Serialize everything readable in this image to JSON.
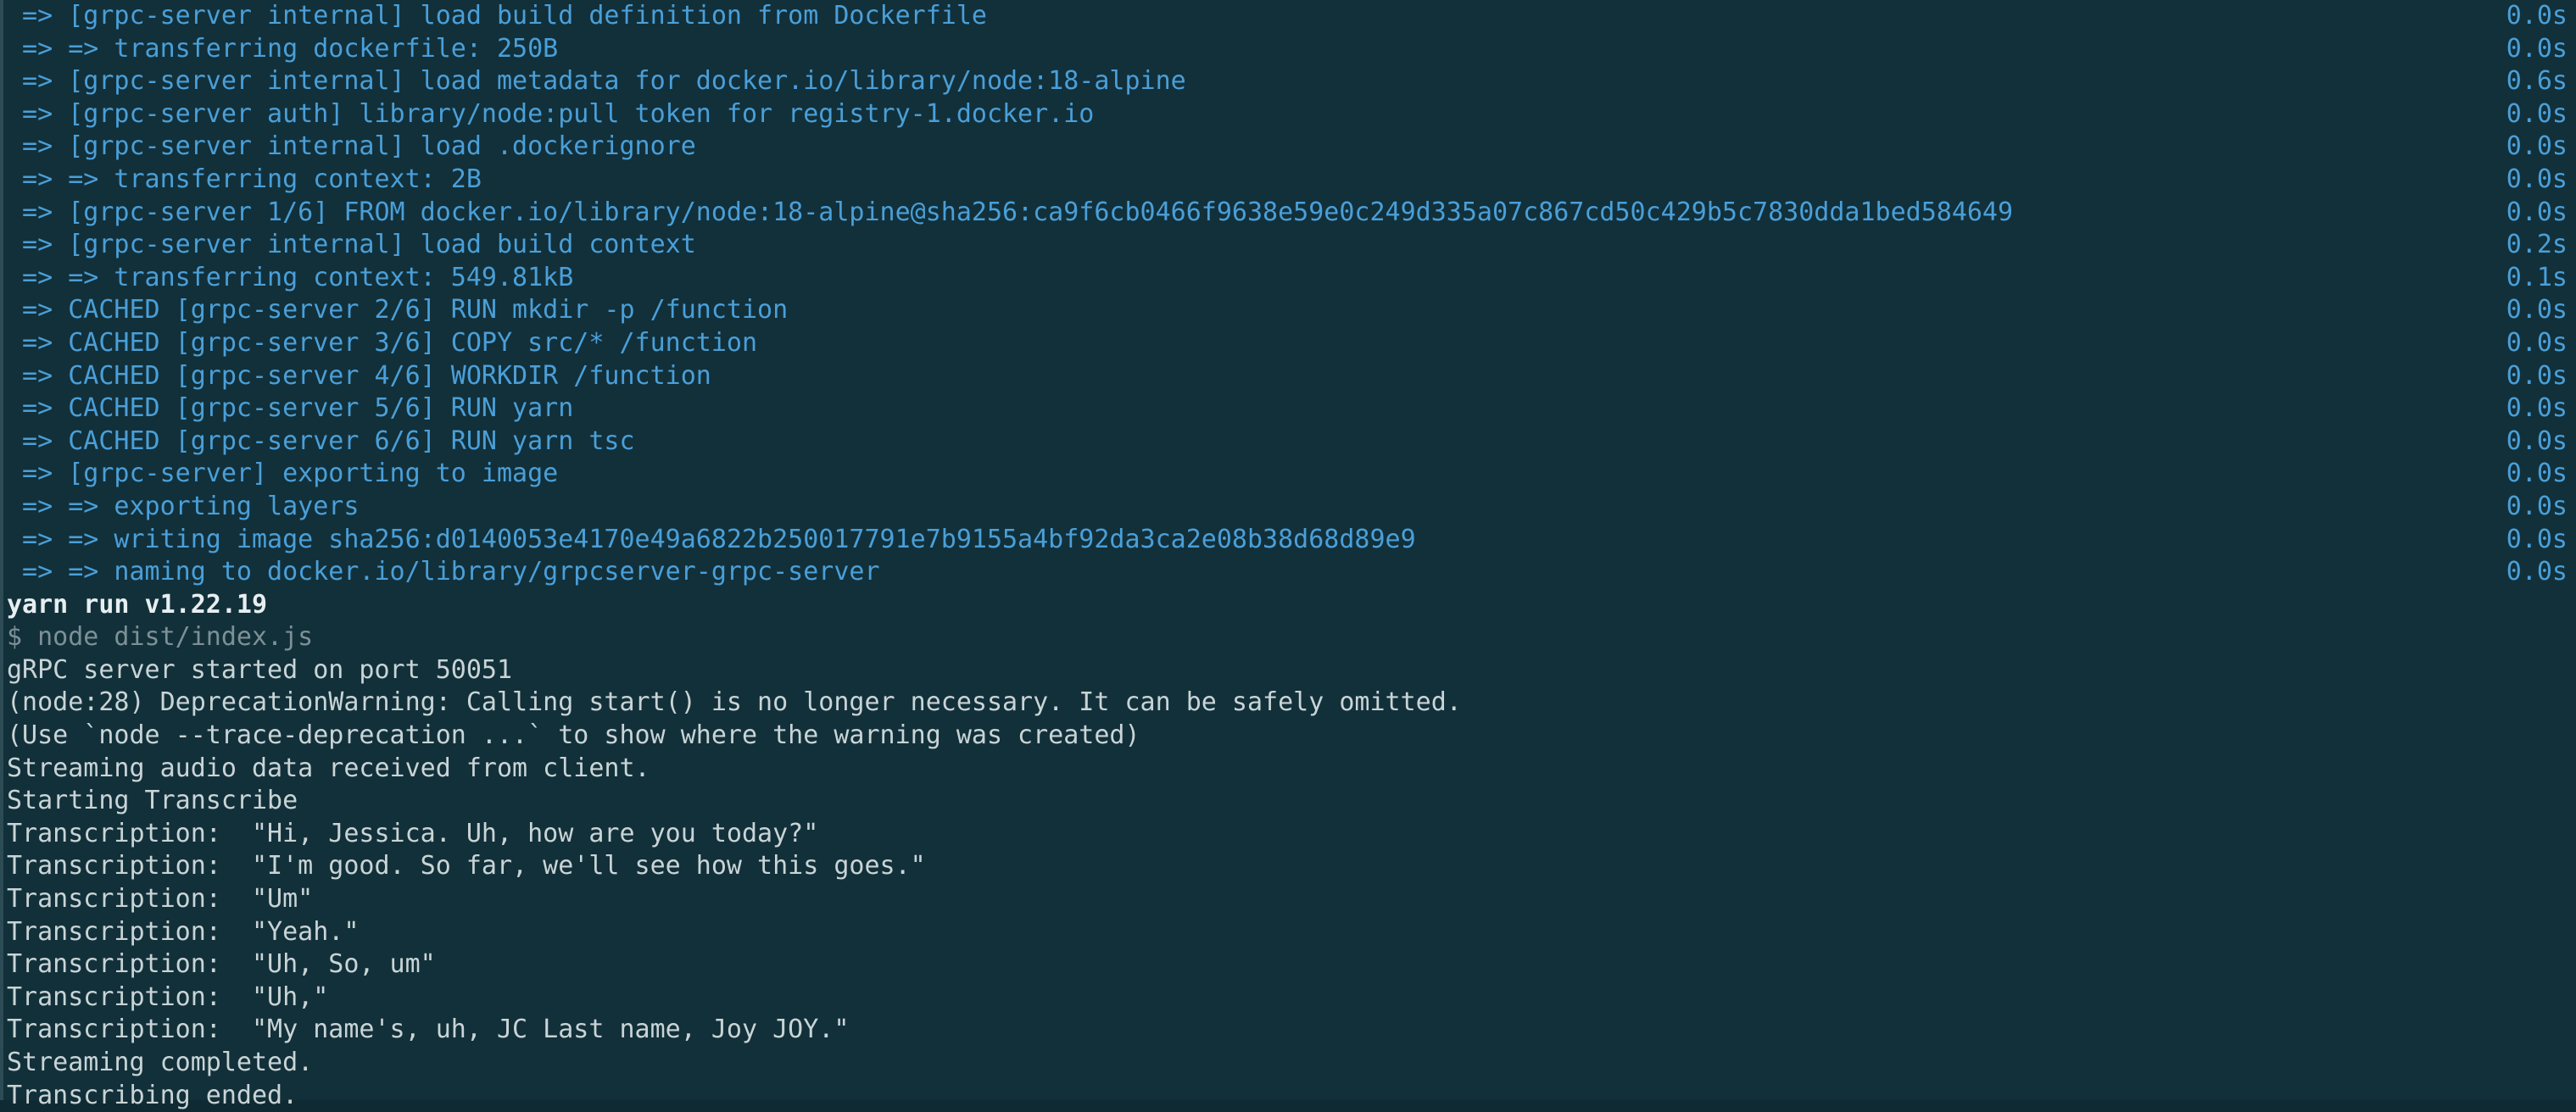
{
  "terminal": {
    "background": "#12303a",
    "build_color": "#4a9fd8",
    "output_color": "#c9d4d6",
    "bold_color": "#e7eef0",
    "dim_color": "#7d9096",
    "edge_color": "#32505a"
  },
  "build_log": [
    {
      "text": " => [grpc-server internal] load build definition from Dockerfile",
      "duration": "0.0s"
    },
    {
      "text": " => => transferring dockerfile: 250B",
      "duration": "0.0s"
    },
    {
      "text": " => [grpc-server internal] load metadata for docker.io/library/node:18-alpine",
      "duration": "0.6s"
    },
    {
      "text": " => [grpc-server auth] library/node:pull token for registry-1.docker.io",
      "duration": "0.0s"
    },
    {
      "text": " => [grpc-server internal] load .dockerignore",
      "duration": "0.0s"
    },
    {
      "text": " => => transferring context: 2B",
      "duration": "0.0s"
    },
    {
      "text": " => [grpc-server 1/6] FROM docker.io/library/node:18-alpine@sha256:ca9f6cb0466f9638e59e0c249d335a07c867cd50c429b5c7830dda1bed584649",
      "duration": "0.0s"
    },
    {
      "text": " => [grpc-server internal] load build context",
      "duration": "0.2s"
    },
    {
      "text": " => => transferring context: 549.81kB",
      "duration": "0.1s"
    },
    {
      "text": " => CACHED [grpc-server 2/6] RUN mkdir -p /function",
      "duration": "0.0s"
    },
    {
      "text": " => CACHED [grpc-server 3/6] COPY src/* /function",
      "duration": "0.0s"
    },
    {
      "text": " => CACHED [grpc-server 4/6] WORKDIR /function",
      "duration": "0.0s"
    },
    {
      "text": " => CACHED [grpc-server 5/6] RUN yarn",
      "duration": "0.0s"
    },
    {
      "text": " => CACHED [grpc-server 6/6] RUN yarn tsc",
      "duration": "0.0s"
    },
    {
      "text": " => [grpc-server] exporting to image",
      "duration": "0.0s"
    },
    {
      "text": " => => exporting layers",
      "duration": "0.0s"
    },
    {
      "text": " => => writing image sha256:d0140053e4170e49a6822b250017791e7b9155a4bf92da3ca2e08b38d68d89e9",
      "duration": "0.0s"
    },
    {
      "text": " => => naming to docker.io/library/grpcserver-grpc-server",
      "duration": "0.0s"
    }
  ],
  "run_output": [
    {
      "text": "yarn run v1.22.19",
      "style": "bold"
    },
    {
      "text": "$ node dist/index.js",
      "style": "dim"
    },
    {
      "text": "gRPC server started on port 50051",
      "style": "out"
    },
    {
      "text": "(node:28) DeprecationWarning: Calling start() is no longer necessary. It can be safely omitted.",
      "style": "out"
    },
    {
      "text": "(Use `node --trace-deprecation ...` to show where the warning was created)",
      "style": "out"
    },
    {
      "text": "Streaming audio data received from client.",
      "style": "out"
    },
    {
      "text": "Starting Transcribe",
      "style": "out"
    },
    {
      "text": "Transcription:  \"Hi, Jessica. Uh, how are you today?\"",
      "style": "out"
    },
    {
      "text": "Transcription:  \"I'm good. So far, we'll see how this goes.\"",
      "style": "out"
    },
    {
      "text": "Transcription:  \"Um\"",
      "style": "out"
    },
    {
      "text": "Transcription:  \"Yeah.\"",
      "style": "out"
    },
    {
      "text": "Transcription:  \"Uh, So, um\"",
      "style": "out"
    },
    {
      "text": "Transcription:  \"Uh,\"",
      "style": "out"
    },
    {
      "text": "Transcription:  \"My name's, uh, JC Last name, Joy JOY.\"",
      "style": "out"
    },
    {
      "text": "Streaming completed.",
      "style": "out"
    },
    {
      "text": "Transcribing ended.",
      "style": "out"
    }
  ]
}
